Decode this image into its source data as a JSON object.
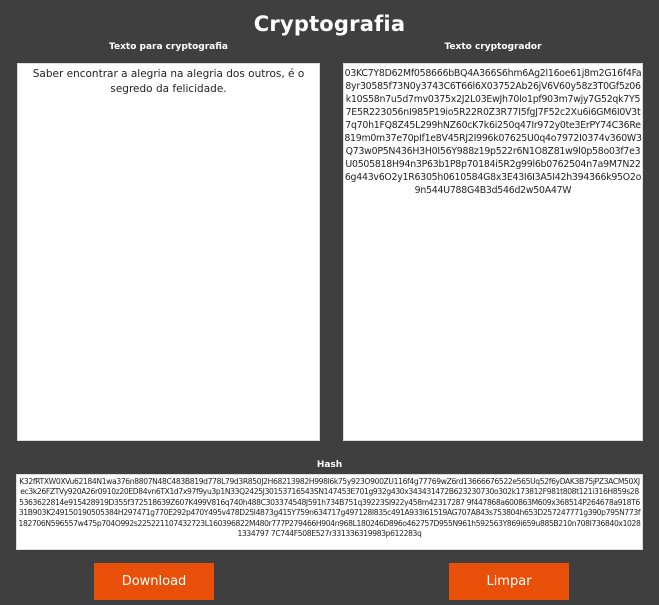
{
  "page": {
    "title": "Cryptografia"
  },
  "plain_panel": {
    "label": "Texto para cryptografia",
    "value": "Saber encontrar a alegria na alegria dos outros, é o segredo da felicidade."
  },
  "cipher_panel": {
    "label": "Texto cryptogrador",
    "value": "03KC7Y8D62Mf058666bBQ4A366S6hm6Ag2l16oe61j8m2G16f4Fa8yr30585f73N0y3743C6T66l6X03752Ab26jV6V60y58z3T0Gf5z06k10S58n7u5d7mv0375x2J2L03EwJh70lo1pf903m7wjy7G52qk7Y57E5R223056nI985P19io5R22R0Z3R77I5fgJ7F52c2Xu6i6GM6I0V3t7q70h1FQ8Z45L299hNZ60cK7k6i250q47Ir972y0te3ErPY74C36Re819m0m37e70pIf1e8V45RJ2I996k07625U0q4o7972I0374v360W3Q73w0P5N436H3H0I56Y988z19p522r6N1O8Z81w9l0p58o03f7e3U0505818H94n3P63b1P8p70184i5R2g99l6b0762504n7a9M7N226g443v6O2y1R6305h0610584G8x3E43I6I3A5I42h394366k95O2o9n544U788G4B3d546d2w50A47W"
  },
  "hash_panel": {
    "label": "Hash",
    "value": "K32fRTXW0XVu62184N1wa376n8807N48C483B819d778L79d3R850J2H68213982H998l6k75y923O900ZU116f4g77769wZ6rd13666676522e565Uq52f6yDAK3B75jPZ3ACM50XJec3k26FZTVy920A26r0910z20ED84vn6TX1d7x97f9yu3p1N33Q2425J30153716543SN147453E701g932g430x343431472B623230730o302k173812F981t808t121i316H859s285363622814e915428919D355f372518639Z607K499V816q740h488C303374548J591h734B751q39223SI922y458m42317287 9f447868a600863M609x368514P264678a918T631B903K249150190505384H297471g770E292p470Y495v478D25I4873g415Y759n634717g497128I835c491A933I61519AG707A843s753804h653D257247771g390p795N773f182706N596557w475p704O992s225221107432723L160396822M480r777P279466H904n968L180246D896o462757D955N961h592563Y869i659u885B210n708I736840x10281334797 7C744F508E527r331336319983p612283q"
  },
  "actions": {
    "download_label": "Download",
    "clear_label": "Limpar"
  },
  "colors": {
    "background": "#3f3f3f",
    "accent": "#e8500a",
    "panel": "#ffffff"
  }
}
